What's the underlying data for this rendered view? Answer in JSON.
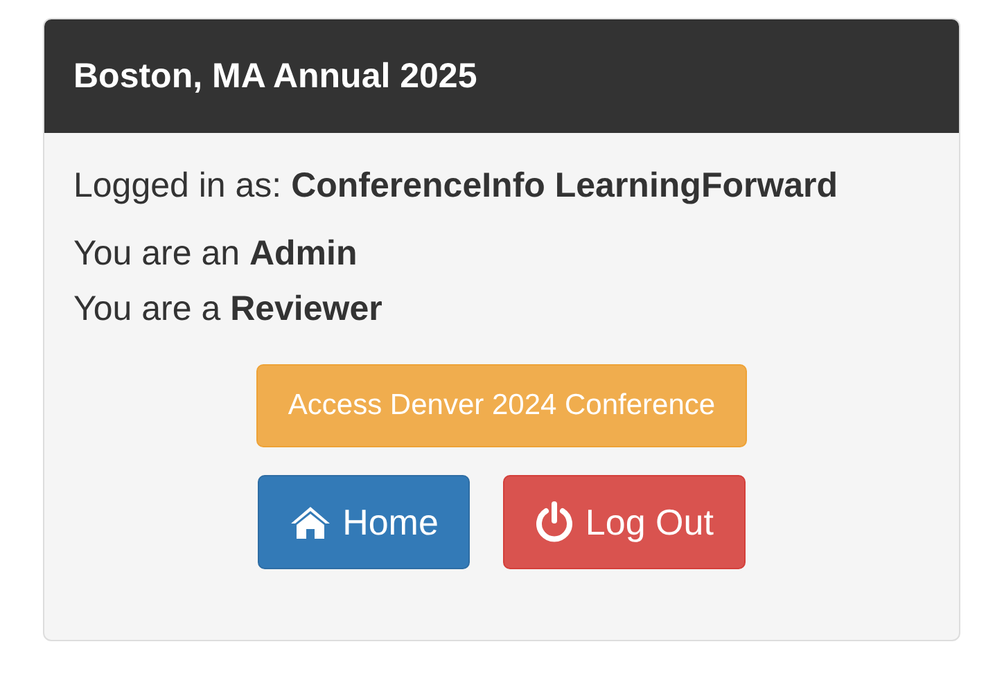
{
  "panel": {
    "title": "Boston, MA Annual 2025"
  },
  "login": {
    "label": "Logged in as: ",
    "user": "ConferenceInfo LearningForward"
  },
  "roles": [
    "You are an **Admin**",
    "You are a **Reviewer**"
  ],
  "access_button": {
    "label": "Access Denver 2024 Conference"
  },
  "buttons": [
    {
      "kind": "home",
      "label": "Home"
    },
    {
      "kind": "logout",
      "label": "Log Out"
    }
  ]
}
